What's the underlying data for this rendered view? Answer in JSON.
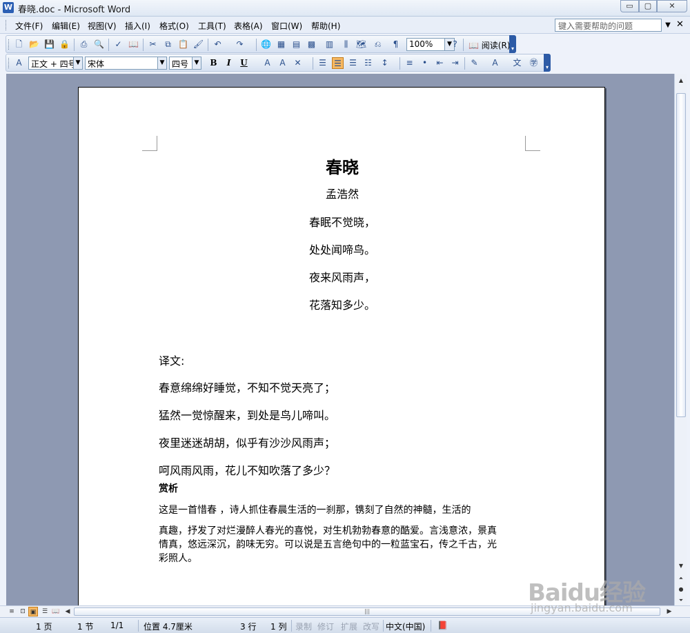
{
  "window": {
    "title": "春晓.doc - Microsoft Word",
    "app_icon": "W",
    "min_glyph": "▭",
    "max_glyph": "▢",
    "close_glyph": "✕"
  },
  "menu": {
    "items": [
      "文件(F)",
      "编辑(E)",
      "视图(V)",
      "插入(I)",
      "格式(O)",
      "工具(T)",
      "表格(A)",
      "窗口(W)",
      "帮助(H)"
    ],
    "help_placeholder": "键入需要帮助的问题",
    "help_drop": "▼",
    "close_doc": "✕"
  },
  "toolbar_standard": {
    "zoom": "100%",
    "read_label": "阅读(R)",
    "icons": [
      "new-icon",
      "open-icon",
      "save-icon",
      "permission-icon",
      "print-icon",
      "print-preview-icon",
      "spelling-icon",
      "research-icon",
      "cut-icon",
      "copy-icon",
      "paste-icon",
      "format-painter-icon",
      "undo-icon",
      "redo-icon",
      "hyperlink-icon",
      "tables-borders-icon",
      "insert-table-icon",
      "insert-excel-icon",
      "columns-icon",
      "drawing-icon",
      "document-map-icon",
      "show-hide-icon"
    ]
  },
  "toolbar_formatting": {
    "style": "正文 + 四号",
    "font": "宋体",
    "size": "四号",
    "bold": "B",
    "italic": "I",
    "underline": "U"
  },
  "document": {
    "title": "春晓",
    "author": "孟浩然",
    "poem": [
      "春眠不觉晓，",
      "处处闻啼鸟。",
      "夜来风雨声，",
      "花落知多少。"
    ],
    "translation_heading": "译文:",
    "translation": [
      "春意绵绵好睡觉，不知不觉天亮了；",
      "猛然一觉惊醒来，到处是鸟儿啼叫。",
      "夜里迷迷胡胡，似乎有沙沙风雨声；",
      "呵风雨风雨，花儿不知吹落了多少？"
    ],
    "appreciation_heading": "赏析",
    "appreciation": [
      "         这是一首惜春  ，诗人抓住春晨生活的一刹那，镌刻了自然的神髓，生活的",
      "真趣，抒发了对烂漫醉人春光的喜悦，对生机勃勃春意的酷爱。言浅意浓，景真",
      "情真，悠远深沉，韵味无穷。可以说是五言绝句中的一粒蓝宝石，传之千古，光",
      "彩照人。"
    ]
  },
  "status": {
    "page": "1 页",
    "section": "1 节",
    "page_of": "1/1",
    "position": "位置 4.7厘米",
    "line": "3 行",
    "column": "1 列",
    "rec": "录制",
    "trk": "修订",
    "ext": "扩展",
    "ovr": "改写",
    "language": "中文(中国)"
  },
  "watermark": {
    "brand": "Baidu经验",
    "url": "jingyan.baidu.com"
  }
}
